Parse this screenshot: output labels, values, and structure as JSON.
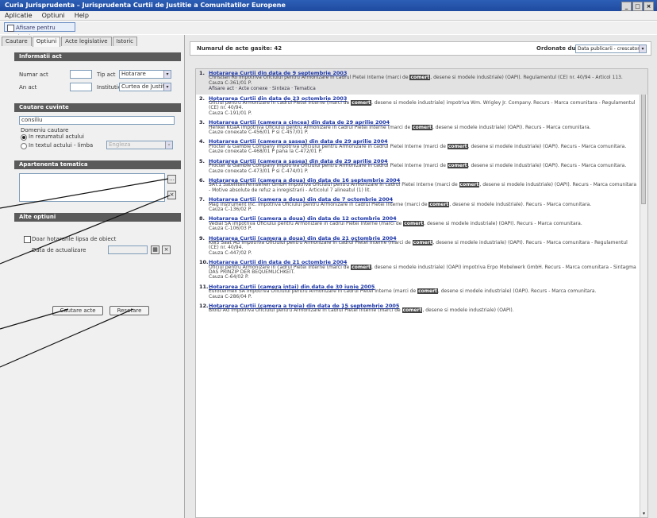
{
  "window": {
    "title": "Curia Jurisprudenta – Jurisprudenta Curtii de Justitie a Comunitatilor Europene"
  },
  "menu": [
    "Aplicatie",
    "Optiuni",
    "Help"
  ],
  "toolbar": {
    "button_label": "Afisare pentru tiparire"
  },
  "tabs": [
    "Cautare",
    "Optiuni",
    "Acte legislative",
    "Istoric"
  ],
  "left": {
    "section_info": "Informatii act",
    "nr_act_label": "Numar act",
    "tip_act_label": "Tip act",
    "tip_act_value": "Hotarare",
    "an_act_label": "An act",
    "institutie_label": "Institutie",
    "institutie_value": "Curtea de Justitie",
    "section_search": "Cautare cuvinte",
    "search_value": "consiliu",
    "search_scope_label": "Domeniu cautare",
    "radio_1": "In rezumatul actului",
    "radio_2": "In textul actului - limba",
    "radio_2_select": "Engleza",
    "section_thematic": "Apartenenta tematica",
    "section_other": "Alte optiuni",
    "checkbox_label": "Doar hotararile lipsa de obiect",
    "date_label": "Data de actualizare",
    "search_button": "Cautare acte",
    "reset_button": "Resetare"
  },
  "main": {
    "count_label": "Numarul de acte gasite: 42",
    "order_label": "Ordonate dupa",
    "order_value": "Data publicarii - crescator",
    "results": [
      {
        "num": "1.",
        "title": "Hotararea Curtii din data de 9 septembrie 2003",
        "desc_a": "Christian Ro impotriva Oficiului pentru Armonizare in cadrul Pietei Interne (marci de ",
        "keyword": "comert",
        "desc_b": ", desene si modele industriale) (OAPI). Regulamentul (CE) nr. 40/94 - Articol 113.",
        "extra": "Cauza C-361/01 P.",
        "links": "Afisare act · Acte conexe · Sinteza · Tematica"
      },
      {
        "num": "2.",
        "title": "Hotararea Curtii din data de 23 octombrie 2003",
        "desc_a": "Oficiul pentru Armonizare in cadrul Pietei Interne (marci de ",
        "keyword": "comert",
        "desc_b": ", desene si modele industriale) impotriva Wm. Wrigley Jr. Company. Recurs - Marca comunitara - Regulamentul (CE) nr. 40/94.",
        "extra": "Cauza C-191/01 P.",
        "links": ""
      },
      {
        "num": "3.",
        "title": "Hotararea Curtii (camera a cincea) din data de 29 aprilie 2004",
        "desc_a": "Henkel KGaA impotriva Oficiului pentru Armonizare in cadrul Pietei Interne (marci de ",
        "keyword": "comert",
        "desc_b": ", desene si modele industriale) (OAPI). Recurs - Marca comunitara.",
        "extra": "Cauze conexate C-456/01 P si C-457/01 P.",
        "links": ""
      },
      {
        "num": "4.",
        "title": "Hotararea Curtii (camera a sasea) din data de 29 aprilie 2004",
        "desc_a": "Procter & Gamble Company impotriva Oficiului pentru Armonizare in cadrul Pietei Interne (marci de ",
        "keyword": "comert",
        "desc_b": ", desene si modele industriale) (OAPI). Recurs - Marca comunitara.",
        "extra": "Cauze conexate C-468/01 P pana la C-472/01 P.",
        "links": ""
      },
      {
        "num": "5.",
        "title": "Hotararea Curtii (camera a sasea) din data de 29 aprilie 2004",
        "desc_a": "Procter & Gamble Company impotriva Oficiului pentru Armonizare in cadrul Pietei Interne (marci de ",
        "keyword": "comert",
        "desc_b": ", desene si modele industriale) (OAPI). Recurs - Marca comunitara.",
        "extra": "Cauze conexate C-473/01 P si C-474/01 P.",
        "links": ""
      },
      {
        "num": "6.",
        "title": "Hotararea Curtii (camera a doua) din data de 16 septembrie 2004",
        "desc_a": "SAT.1 SatellitenFernsehen GmbH impotriva Oficiului pentru Armonizare in cadrul Pietei Interne (marci de ",
        "keyword": "comert",
        "desc_b": ", desene si modele industriale) (OAPI). Recurs - Marca comunitara - Motive absolute de refuz a inregistrarii - Articolul 7 alineatul (1) lit.",
        "extra": "",
        "links": ""
      },
      {
        "num": "7.",
        "title": "Hotararea Curtii (camera a doua) din data de 7 octombrie 2004",
        "desc_a": "Mag Instrument Inc. impotriva Oficiului pentru Armonizare in cadrul Pietei Interne (marci de ",
        "keyword": "comert",
        "desc_b": ", desene si modele industriale). Recurs - Marca comunitara.",
        "extra": "Cauza C-136/02 P.",
        "links": ""
      },
      {
        "num": "8.",
        "title": "Hotararea Curtii (camera a doua) din data de 12 octombrie 2004",
        "desc_a": "Vedial SA impotriva Oficiului pentru Armonizare in cadrul Pietei Interne (marci de ",
        "keyword": "comert",
        "desc_b": ", desene si modele industriale) (OAPI). Recurs - Marca comunitara.",
        "extra": "Cauza C-106/03 P.",
        "links": ""
      },
      {
        "num": "9.",
        "title": "Hotararea Curtii (camera a doua) din data de 21 octombrie 2004",
        "desc_a": "KWS Saat AG impotriva Oficiului pentru Armonizare in cadrul Pietei Interne (marci de ",
        "keyword": "comert",
        "desc_b": ", desene si modele industriale) (OAPI). Recurs - Marca comunitara - Regulamentul (CE) nr. 40/94.",
        "extra": "Cauza C-447/02 P.",
        "links": ""
      },
      {
        "num": "10.",
        "title": "Hotararea Curtii din data de 21 octombrie 2004",
        "desc_a": "Oficiul pentru Armonizare in cadrul Pietei Interne (marci de ",
        "keyword": "comert",
        "desc_b": ", desene si modele industriale) (OAPI) impotriva Erpo Mobelwerk GmbH. Recurs - Marca comunitara - Sintagma DAS PRINZIP DER BEQUEMLICHKEIT.",
        "extra": "Cauza C-64/02 P.",
        "links": ""
      },
      {
        "num": "11.",
        "title": "Hotararea Curtii (camera intai) din data de 30 iunie 2005",
        "desc_a": "Eurocermex SA impotriva Oficiului pentru Armonizare in cadrul Pietei Interne (marci de ",
        "keyword": "comert",
        "desc_b": ", desene si modele industriale) (OAPI). Recurs - Marca comunitara.",
        "extra": "Cauza C-286/04 P.",
        "links": ""
      },
      {
        "num": "12.",
        "title": "Hotararea Curtii (camera a treia) din data de 15 septembrie 2005",
        "desc_a": "BioID AG impotriva Oficiului pentru Armonizare in cadrul Pietei Interne (marci de ",
        "keyword": "comert",
        "desc_b": ", desene si modele industriale) (OAPI).",
        "extra": "",
        "links": ""
      }
    ]
  }
}
